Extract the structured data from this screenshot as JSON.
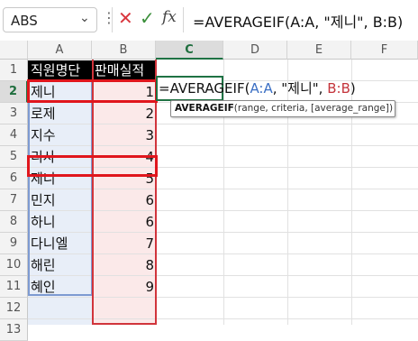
{
  "formula_bar": {
    "name_box": "ABS",
    "formula": "=AVERAGEIF(A:A, \"제니\", B:B)"
  },
  "columns": [
    "A",
    "B",
    "C",
    "D",
    "E",
    "F"
  ],
  "rows": [
    "1",
    "2",
    "3",
    "4",
    "5",
    "6",
    "7",
    "8",
    "9",
    "10",
    "11",
    "12",
    "13"
  ],
  "header_row": {
    "A": "직원명단",
    "B": "판매실적"
  },
  "data_rows": [
    {
      "name": "제니",
      "sales": "1"
    },
    {
      "name": "로제",
      "sales": "2"
    },
    {
      "name": "지수",
      "sales": "3"
    },
    {
      "name": "리사",
      "sales": "4"
    },
    {
      "name": "제니",
      "sales": "5"
    },
    {
      "name": "민지",
      "sales": "6"
    },
    {
      "name": "하니",
      "sales": "6"
    },
    {
      "name": "다니엘",
      "sales": "7"
    },
    {
      "name": "해린",
      "sales": "8"
    },
    {
      "name": "혜인",
      "sales": "9"
    }
  ],
  "edit": {
    "prefix": "=AVERAGEIF(",
    "ref_a": "A:A",
    "middle": ", \"제니\", ",
    "ref_b": "B:B",
    "suffix": ")"
  },
  "tooltip": {
    "func": "AVERAGEIF",
    "args": "(range, criteria, [average_range])"
  },
  "colors": {
    "highlight": "#e0161d",
    "active": "#1f7244",
    "refA": "#3b6fc4",
    "refB": "#c4343b"
  }
}
